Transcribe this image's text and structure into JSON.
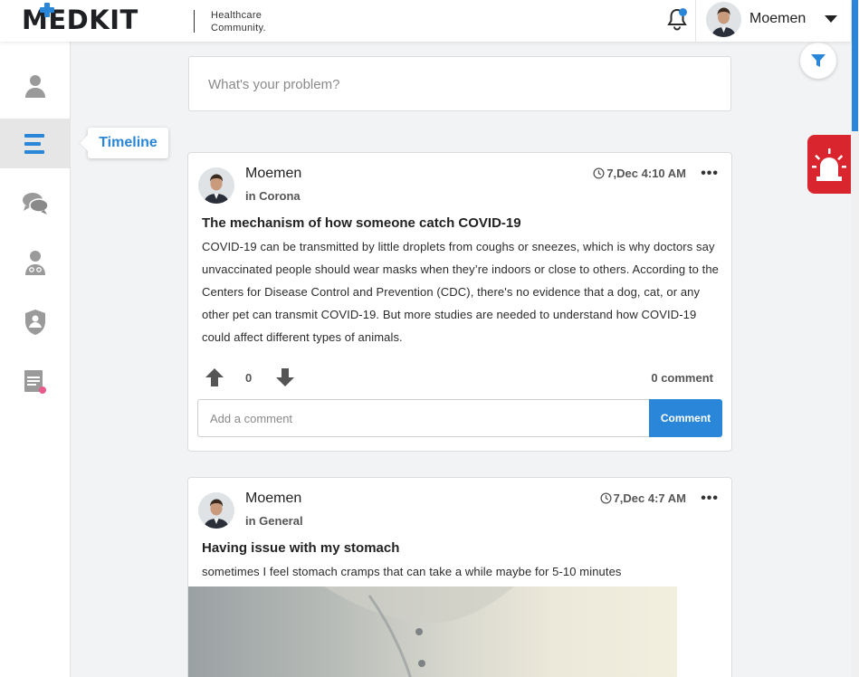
{
  "header": {
    "logo": "MEDKIT",
    "tagline_line1": "Healthcare",
    "tagline_line2": "Community.",
    "user_name": "Moemen"
  },
  "sidebar": {
    "items": [
      {
        "icon": "user-icon"
      },
      {
        "icon": "timeline-icon",
        "active": true,
        "tooltip": "Timeline"
      },
      {
        "icon": "chat-icon"
      },
      {
        "icon": "doctor-icon"
      },
      {
        "icon": "shield-icon"
      },
      {
        "icon": "prescription-icon"
      }
    ]
  },
  "composer": {
    "placeholder": "What's your problem?"
  },
  "posts": [
    {
      "author": "Moemen",
      "category": "in Corona",
      "time": "7,Dec 4:10 AM",
      "title": "The mechanism of how someone catch COVID-19",
      "body": "COVID-19 can be transmitted by little droplets from coughs or sneezes, which is why doctors say unvaccinated people should wear masks when they’re indoors or close to others. According to the Centers for Disease Control and Prevention (CDC), there's no evidence that a dog, cat, or any other pet can transmit COVID-19. But more studies are needed to understand how COVID-19 could affect different types of animals.",
      "votes": "0",
      "comments": "0 comment",
      "comment_placeholder": "Add a comment",
      "comment_button": "Comment"
    },
    {
      "author": "Moemen",
      "category": "in General",
      "time": "7,Dec 4:7 AM",
      "title": "Having issue with my stomach",
      "body": "sometimes I feel stomach cramps that can take a while maybe for 5-10 minutes"
    }
  ],
  "colors": {
    "accent": "#2a86d8",
    "alarm": "#d9262e"
  }
}
